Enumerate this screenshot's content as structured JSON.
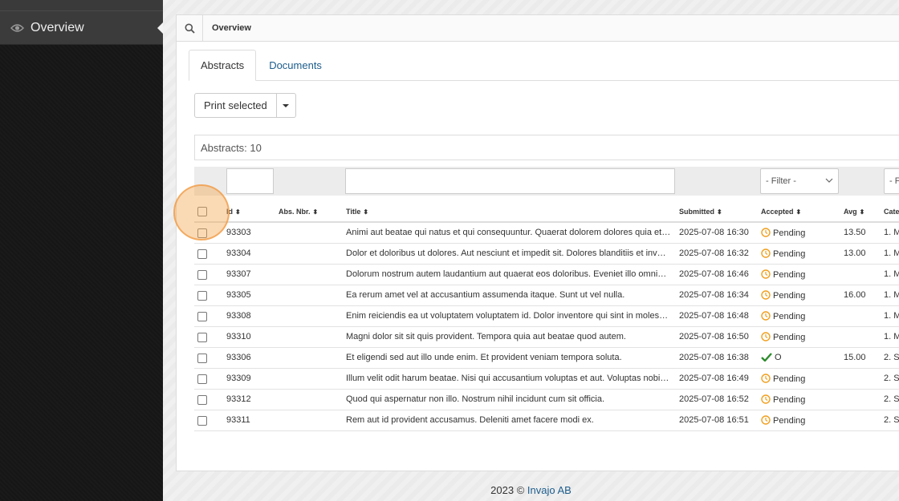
{
  "sidebar": {
    "items": [
      {
        "label": "Overview",
        "icon": "eye-icon"
      }
    ]
  },
  "topbar": {
    "breadcrumb": "Overview",
    "search_icon": "search-icon"
  },
  "tabs": [
    {
      "label": "Abstracts",
      "active": true
    },
    {
      "label": "Documents",
      "active": false
    }
  ],
  "toolbar": {
    "print_label": "Print selected"
  },
  "count_label": "Abstracts: 10",
  "filters": {
    "accepted_placeholder": "- Filter -",
    "category_placeholder": "- F"
  },
  "columns": {
    "id": "Id",
    "abs_nbr": "Abs. Nbr.",
    "title": "Title",
    "submitted": "Submitted",
    "accepted": "Accepted",
    "avg": "Avg",
    "category": "Cate"
  },
  "rows": [
    {
      "id": "93303",
      "abs": "",
      "title": "Animi aut beatae qui natus et qui consequuntur. Quaerat dolorem dolores quia et…",
      "submitted": "2025-07-08 16:30",
      "status": "Pending",
      "status_icon": "clock-icon",
      "avg": "13.50",
      "cat": "1. M"
    },
    {
      "id": "93304",
      "abs": "",
      "title": "Dolor et doloribus ut dolores. Aut nesciunt et impedit sit. Dolores blanditiis et inv…",
      "submitted": "2025-07-08 16:32",
      "status": "Pending",
      "status_icon": "clock-icon",
      "avg": "13.00",
      "cat": "1. M"
    },
    {
      "id": "93307",
      "abs": "",
      "title": "Dolorum nostrum autem laudantium aut quaerat eos doloribus. Eveniet illo omni…",
      "submitted": "2025-07-08 16:46",
      "status": "Pending",
      "status_icon": "clock-icon",
      "avg": "",
      "cat": "1. M"
    },
    {
      "id": "93305",
      "abs": "",
      "title": "Ea rerum amet vel at accusantium assumenda itaque. Sunt ut vel nulla.",
      "submitted": "2025-07-08 16:34",
      "status": "Pending",
      "status_icon": "clock-icon",
      "avg": "16.00",
      "cat": "1. M"
    },
    {
      "id": "93308",
      "abs": "",
      "title": "Enim reiciendis ea ut voluptatem voluptatem id. Dolor inventore qui sint in moles…",
      "submitted": "2025-07-08 16:48",
      "status": "Pending",
      "status_icon": "clock-icon",
      "avg": "",
      "cat": "1. M"
    },
    {
      "id": "93310",
      "abs": "",
      "title": "Magni dolor sit sit quis provident. Tempora quia aut beatae quod autem.",
      "submitted": "2025-07-08 16:50",
      "status": "Pending",
      "status_icon": "clock-icon",
      "avg": "",
      "cat": "1. M"
    },
    {
      "id": "93306",
      "abs": "",
      "title": "Et eligendi sed aut illo unde enim. Et provident veniam tempora soluta.",
      "submitted": "2025-07-08 16:38",
      "status": "O",
      "status_icon": "check-icon",
      "avg": "15.00",
      "cat": "2. S"
    },
    {
      "id": "93309",
      "abs": "",
      "title": "Illum velit odit harum beatae. Nisi qui accusantium voluptas et aut. Voluptas nobi…",
      "submitted": "2025-07-08 16:49",
      "status": "Pending",
      "status_icon": "clock-icon",
      "avg": "",
      "cat": "2. S"
    },
    {
      "id": "93312",
      "abs": "",
      "title": "Quod qui aspernatur non illo. Nostrum nihil incidunt cum sit officia.",
      "submitted": "2025-07-08 16:52",
      "status": "Pending",
      "status_icon": "clock-icon",
      "avg": "",
      "cat": "2. S"
    },
    {
      "id": "93311",
      "abs": "",
      "title": "Rem aut id provident accusamus. Deleniti amet facere modi ex.",
      "submitted": "2025-07-08 16:51",
      "status": "Pending",
      "status_icon": "clock-icon",
      "avg": "",
      "cat": "2. S"
    }
  ],
  "footer": {
    "text": "2023 ©",
    "link": "Invajo AB"
  },
  "colors": {
    "link": "#1d5d8c",
    "pending": "#f0a020",
    "accepted": "#2e8b2e",
    "highlight": "#f5aa5a"
  }
}
